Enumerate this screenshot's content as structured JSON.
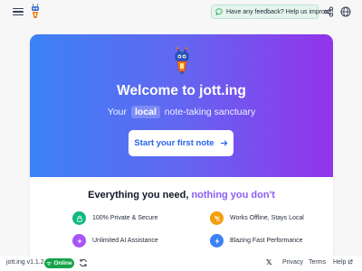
{
  "topbar": {
    "feedback_label": "Have any feedback? Help us improve!"
  },
  "hero": {
    "title": "Welcome to jott.ing",
    "subtitle_before": "Your",
    "subtitle_pill": "local",
    "subtitle_after": "note-taking sanctuary",
    "cta_label": "Start your first note"
  },
  "features": {
    "title_main": "Everything you need,",
    "title_accent": "nothing you don't",
    "items": [
      {
        "label": "100% Private & Secure",
        "icon": "lock-icon",
        "color": "#10b981"
      },
      {
        "label": "Works Offline, Stays Local",
        "icon": "wifi-off-icon",
        "color": "#f59e0b"
      },
      {
        "label": "Unlimited AI Assistance",
        "icon": "sparkles-icon",
        "color": "#a855f7"
      },
      {
        "label": "Blazing Fast Performance",
        "icon": "lightning-icon",
        "color": "#3b82f6"
      }
    ]
  },
  "footer": {
    "version": "jott.ing v1.1.2",
    "status": "Online",
    "links": {
      "privacy": "Privacy",
      "terms": "Terms",
      "help": "Help"
    }
  },
  "colors": {
    "gradient_start": "#3b82f6",
    "gradient_end": "#9333ea",
    "accent_purple": "#8b5cf6",
    "online_green": "#16a34a",
    "cta_text": "#2563eb"
  }
}
